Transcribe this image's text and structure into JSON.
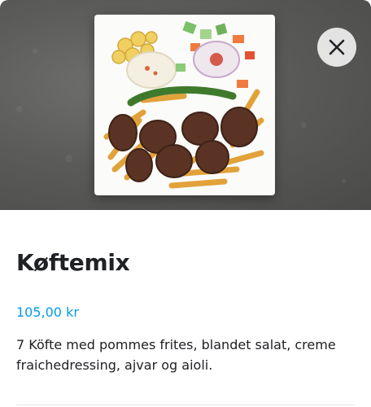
{
  "item": {
    "name": "Køftemix",
    "price": "105,00 kr",
    "description": "7 Köfte med pommes frites, blandet salat, creme fraichedressing, ajvar og aioli."
  },
  "image": {
    "subject": "food-photo",
    "close_icon": "close-icon"
  },
  "colors": {
    "price": "#009de0",
    "text": "#202125",
    "close_bg": "#f0f0f0"
  }
}
